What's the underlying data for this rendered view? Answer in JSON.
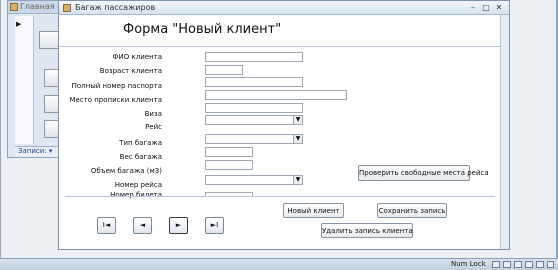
{
  "back_window": {
    "title": "Главная",
    "status": "Записи: ▾"
  },
  "form_window": {
    "title": "Багаж пассажиров",
    "controls": {
      "minimize": "–",
      "maximize": "□",
      "close": "✕"
    }
  },
  "form": {
    "heading": "Форма \"Новый клиент\"",
    "fields": [
      {
        "label": "ФИО клиента",
        "value": ""
      },
      {
        "label": "Возраст клиента",
        "value": ""
      },
      {
        "label": "Полный номер паспорта",
        "value": ""
      },
      {
        "label": "Место прописки клиента",
        "value": ""
      },
      {
        "label": "Виза",
        "value": ""
      },
      {
        "label": "Рейс",
        "value": ""
      },
      {
        "label": "Тип багажа",
        "value": ""
      },
      {
        "label": "Вес багажа",
        "value": ""
      },
      {
        "label": "Объем багажа (м3)",
        "value": ""
      },
      {
        "label": "Номер рейса",
        "value": ""
      },
      {
        "label": "Номер билета",
        "value": ""
      }
    ],
    "buttons": {
      "check_places": "Проверить свободные места рейса",
      "new_client": "Новый клиент",
      "save_record": "Сохранить запись",
      "delete_record": "Удалить запись клиента"
    },
    "nav": {
      "first": "I◄",
      "prev": "◄",
      "next": "►",
      "last": "►I"
    }
  },
  "status_bar": {
    "num_lock": "Num Lock"
  }
}
